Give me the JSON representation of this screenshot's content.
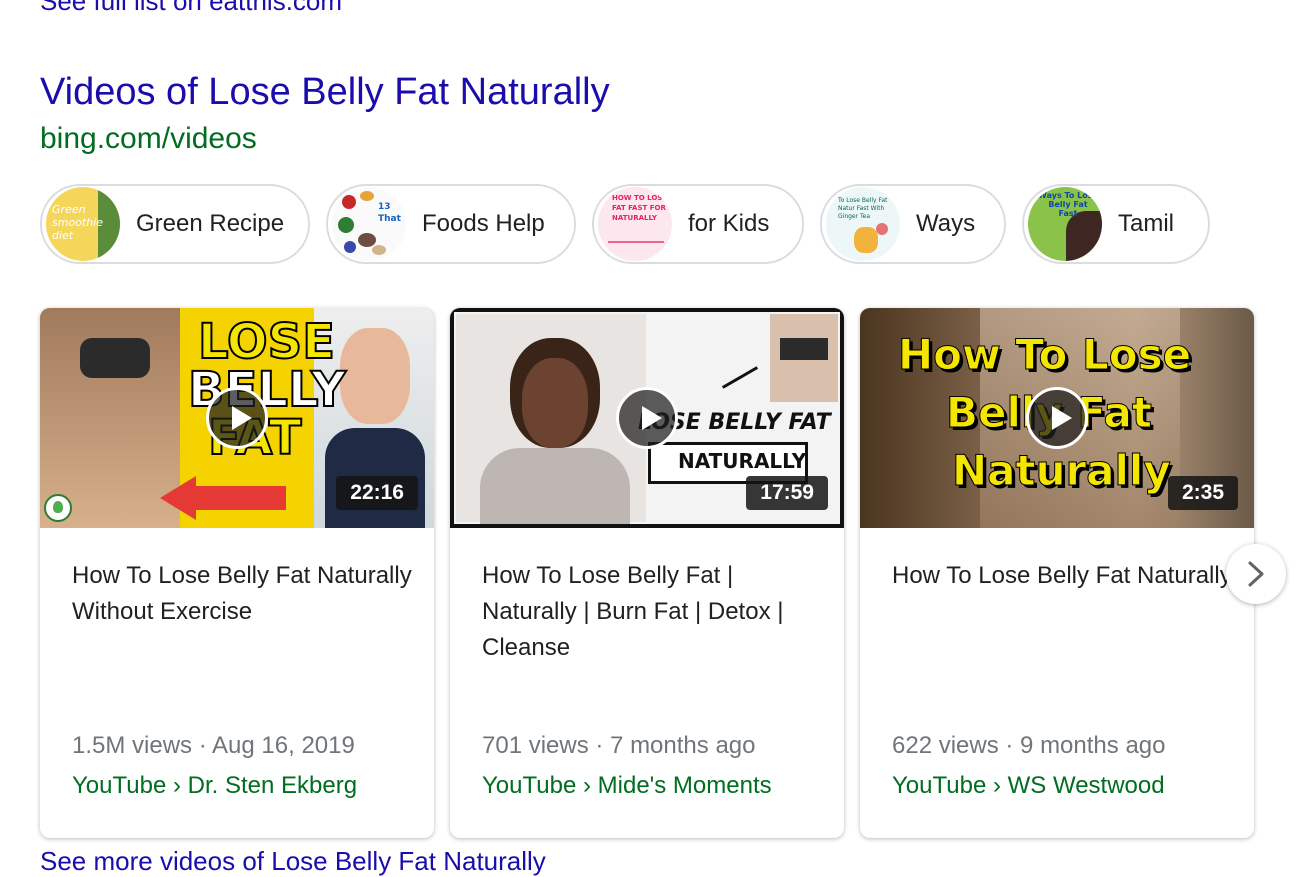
{
  "top_link": "See full list on eatthis.com",
  "section": {
    "title": "Videos of Lose Belly Fat Naturally",
    "url": "bing.com/videos"
  },
  "pills": [
    {
      "label": "Green Recipe",
      "thumb_text": "Green smoothie diet"
    },
    {
      "label": "Foods Help",
      "thumb_text": "13 That"
    },
    {
      "label": "for Kids",
      "thumb_text": "HOW TO LOSE FAT FAST FOR NATURALLY"
    },
    {
      "label": "Ways",
      "thumb_text": "To Lose Belly Fat Natur Fast With Ginger Tea"
    },
    {
      "label": "Tamil",
      "thumb_text": "Ways To Lose Belly Fat Fast"
    }
  ],
  "videos": [
    {
      "title": "How To Lose Belly Fat Naturally Without Exercise",
      "duration": "22:16",
      "meta": "1.5M views · Aug 16, 2019",
      "source": "YouTube › Dr. Sten Ekberg",
      "thumb_text": [
        "LOSE",
        "BELLY",
        "FAT"
      ]
    },
    {
      "title": "How To Lose Belly Fat | Naturally | Burn Fat | Detox | Cleanse",
      "duration": "17:59",
      "meta": "701 views · 7 months ago",
      "source": "YouTube › Mide's Moments",
      "thumb_text": [
        "LOSE BELLY FAT",
        "NATURALLY"
      ]
    },
    {
      "title": "How To Lose Belly Fat Naturally",
      "duration": "2:35",
      "meta": "622 views · 9 months ago",
      "source": "YouTube › WS Westwood",
      "thumb_text": [
        "How To Lose",
        "Belly Fat",
        "Naturally"
      ]
    }
  ],
  "bottom_link": "See more videos of Lose Belly Fat Naturally",
  "colors": {
    "link": "#1a0dab",
    "url_green": "#006d21",
    "text": "#202124",
    "meta_gray": "#70757a"
  }
}
